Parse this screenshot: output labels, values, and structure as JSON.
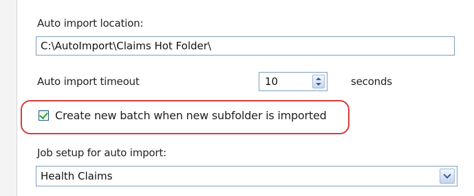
{
  "auto_import_location": {
    "label": "Auto import location:",
    "value": "C:\\AutoImport\\Claims Hot Folder\\"
  },
  "auto_import_timeout": {
    "label": "Auto import timeout",
    "value": "10",
    "unit": "seconds"
  },
  "create_batch": {
    "label": "Create new batch when new subfolder is imported",
    "checked": true
  },
  "job_setup": {
    "label": "Job setup for auto import:",
    "selected": "Health Claims"
  },
  "colors": {
    "highlight": "#d83a3a",
    "field_border": "#7f9db9",
    "check": "#21a121"
  },
  "icons": {
    "spinner": "up-down-arrows-icon",
    "checkbox": "checkmark-icon",
    "dropdown": "chevron-down-icon"
  }
}
